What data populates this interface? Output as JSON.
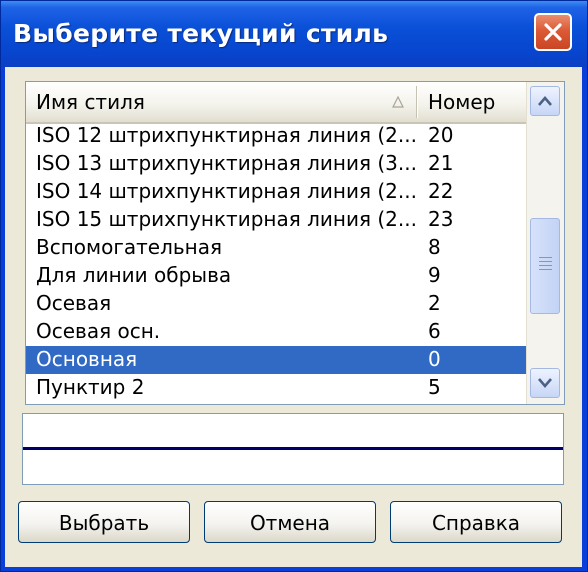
{
  "window": {
    "title": "Выберите текущий стиль"
  },
  "list": {
    "columns": {
      "name": "Имя стиля",
      "number": "Номер"
    },
    "rows": [
      {
        "name": "ISO 12 штрихпунктирная линия (2...",
        "number": "20"
      },
      {
        "name": "ISO 13 штрихпунктирная линия (3...",
        "number": "21"
      },
      {
        "name": "ISO 14 штрихпунктирная линия (2...",
        "number": "22"
      },
      {
        "name": "ISO 15 штрихпунктирная линия (2...",
        "number": "23"
      },
      {
        "name": "Вспомогательная",
        "number": "8"
      },
      {
        "name": "Для линии обрыва",
        "number": "9"
      },
      {
        "name": "Осевая",
        "number": "2"
      },
      {
        "name": "Осевая осн.",
        "number": "6"
      },
      {
        "name": "Основная",
        "number": "0",
        "selected": true
      },
      {
        "name": "Пунктир 2",
        "number": "5"
      }
    ]
  },
  "buttons": {
    "select": "Выбрать",
    "cancel": "Отмена",
    "help": "Справка"
  },
  "colors": {
    "selection": "#316ac5",
    "title_bar": "#0a50d8",
    "preview_line": "#000066"
  },
  "icons": {
    "close": "close-icon",
    "sort": "sort-indicator-icon",
    "scroll_up": "chevron-up-icon",
    "scroll_down": "chevron-down-icon"
  }
}
